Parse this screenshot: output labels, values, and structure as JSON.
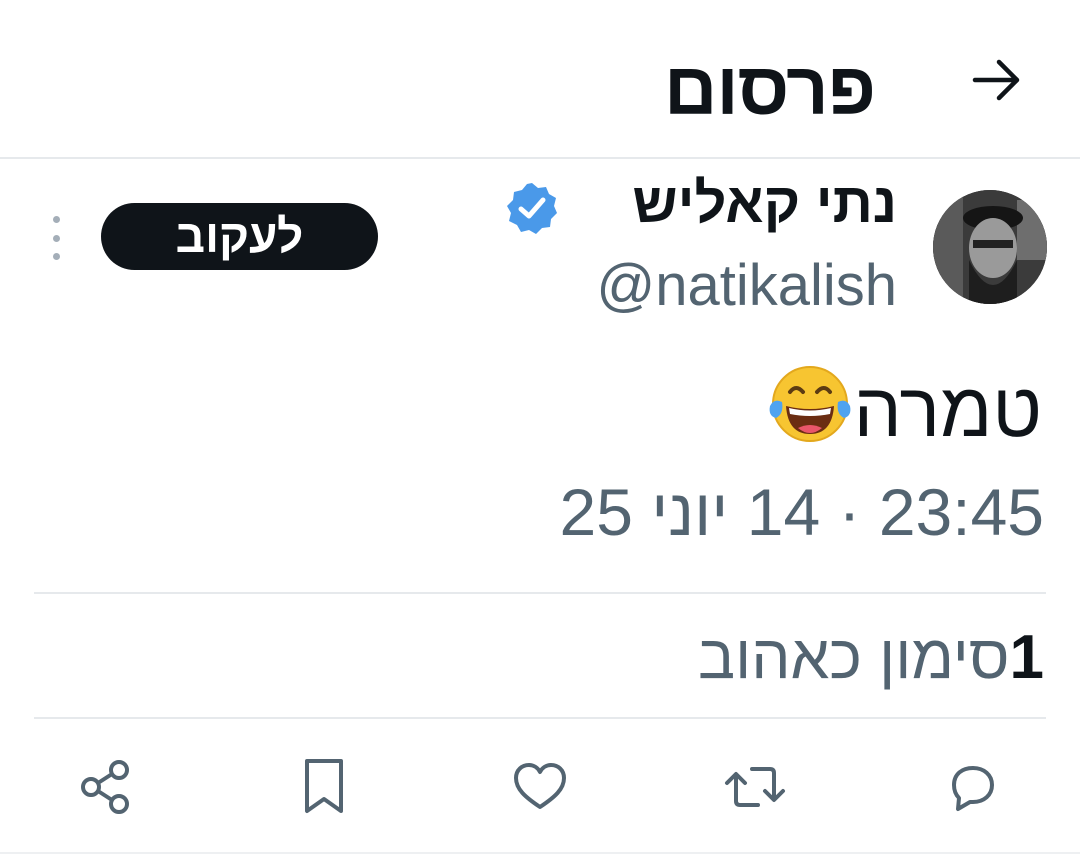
{
  "header": {
    "title": "פרסום",
    "back_icon": "arrow-right-icon"
  },
  "author": {
    "name": "נתי קאליש",
    "handle": "@natikalish",
    "verified": true,
    "verified_color": "#4a99e9"
  },
  "follow_button": {
    "label": "לעקוב"
  },
  "tweet": {
    "text": "טמרה",
    "emoji": "face-with-tears-of-joy-emoji",
    "timestamp": "23:45 · 14 יוני 25"
  },
  "stats": {
    "likes_count": "1",
    "likes_label": "סימון כאהוב"
  },
  "actions": [
    "reply-icon",
    "retweet-icon",
    "like-icon",
    "bookmark-icon",
    "share-icon"
  ],
  "colors": {
    "primary_text": "#0f1419",
    "secondary_text": "#536471",
    "divider": "#e6e9ec",
    "icon": "#536471"
  }
}
